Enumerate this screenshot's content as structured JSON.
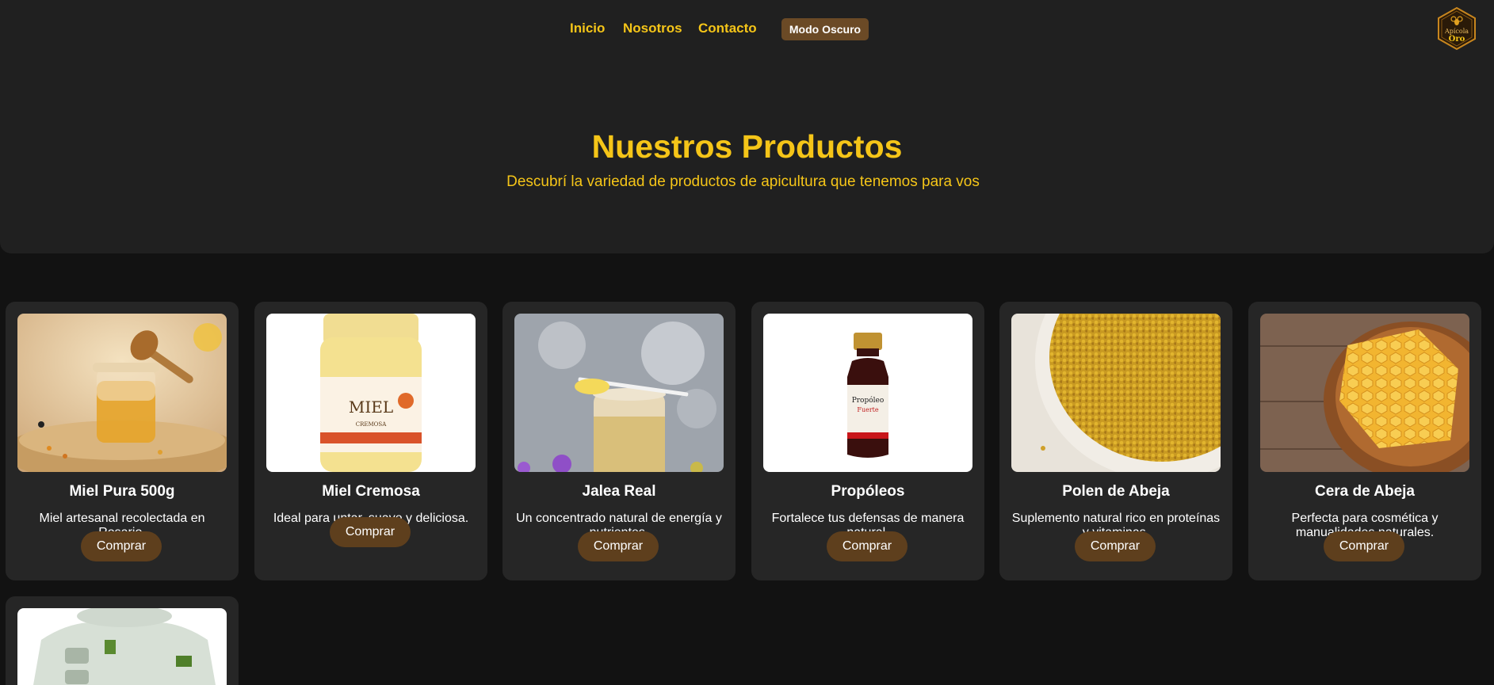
{
  "nav": {
    "links": [
      "Inicio",
      "Nosotros",
      "Contacto"
    ],
    "mode_button": "Modo Oscuro"
  },
  "logo": {
    "line1": "Apícola",
    "line2": "Oro",
    "icon": "bee-hexagon-logo"
  },
  "hero": {
    "title": "Nuestros Productos",
    "subtitle": "Descubrí la variedad de productos de apicultura que tenemos para vos"
  },
  "products": [
    {
      "title": "Miel Pura 500g",
      "description": "Miel artesanal recolectada en Rosario.",
      "button": "Comprar",
      "image": "honey-jar-dipper-image"
    },
    {
      "title": "Miel Cremosa",
      "description": "Ideal para untar, suave y deliciosa.",
      "button": "Comprar",
      "image": "creamy-honey-jar-image"
    },
    {
      "title": "Jalea Real",
      "description": "Un concentrado natural de energía y nutrientes.",
      "button": "Comprar",
      "image": "royal-jelly-jar-image"
    },
    {
      "title": "Propóleos",
      "description": "Fortalece tus defensas de manera natural.",
      "button": "Comprar",
      "image": "propolis-bottle-image"
    },
    {
      "title": "Polen de Abeja",
      "description": "Suplemento natural rico en proteínas y vitaminas.",
      "button": "Comprar",
      "image": "bee-pollen-bowl-image"
    },
    {
      "title": "Cera de Abeja",
      "description": "Perfecta para cosmética y manualidades naturales.",
      "button": "Comprar",
      "image": "honeycomb-bowl-image"
    },
    {
      "title": "",
      "description": "",
      "button": "",
      "image": "beekeeper-suit-image"
    }
  ],
  "colors": {
    "accent": "#f5c518",
    "button": "#5e3f1d",
    "card": "#262626",
    "hero": "#202020",
    "background": "#121212"
  }
}
